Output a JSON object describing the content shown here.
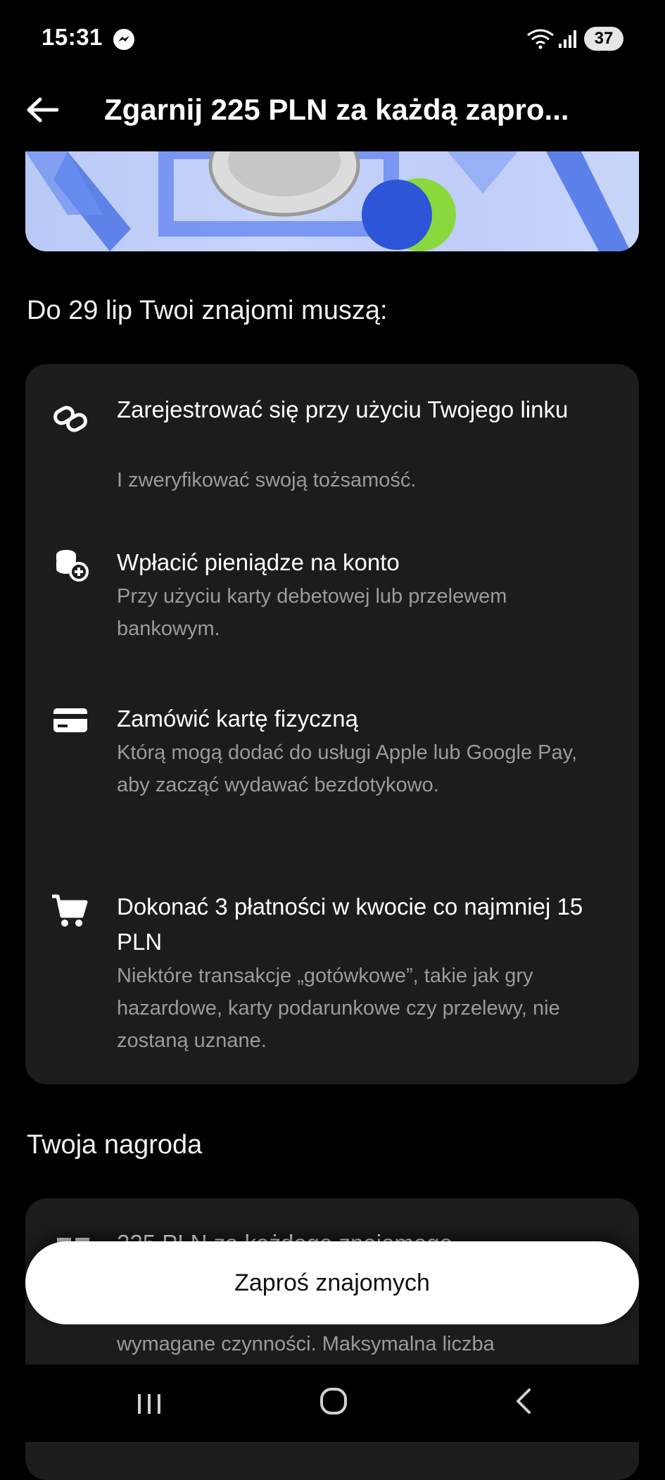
{
  "status_bar": {
    "time": "15:31",
    "battery": "37",
    "notification_icon": "messenger-icon"
  },
  "app_bar": {
    "title": "Zgarnij 225 PLN za każdą zapro..."
  },
  "requirements": {
    "heading": "Do 29 lip Twoi znajomi muszą:",
    "items": [
      {
        "icon": "link-icon",
        "title": "Zarejestrować się przy użyciu Twojego linku",
        "description": "I zweryfikować swoją tożsamość."
      },
      {
        "icon": "coins-add-icon",
        "title": "Wpłacić pieniądze na konto",
        "description": "Przy użyciu karty debetowej lub przelewem bankowym."
      },
      {
        "icon": "card-icon",
        "title": "Zamówić kartę fizyczną",
        "description": "Którą mogą dodać do usługi Apple lub Google Pay, aby zacząć wydawać bezdotykowo."
      },
      {
        "icon": "cart-icon",
        "title": "Dokonać 3 płatności w kwocie co najmniej 15 PLN",
        "description": "Niektóre transakcje „gotówkowe”, takie jak gry hazardowe, karty podarunkowe czy przelewy, nie zostaną uznane."
      }
    ]
  },
  "reward": {
    "heading": "Twoja nagroda",
    "title": "225 PLN za każdego znajomego",
    "description": "wymagane czynności. Maksymalna liczba"
  },
  "cta": {
    "label": "Zaproś znajomych"
  },
  "colors": {
    "background": "#000000",
    "card": "#1c1c1e",
    "secondary_text": "#9a9aa0",
    "button": "#ffffff"
  }
}
